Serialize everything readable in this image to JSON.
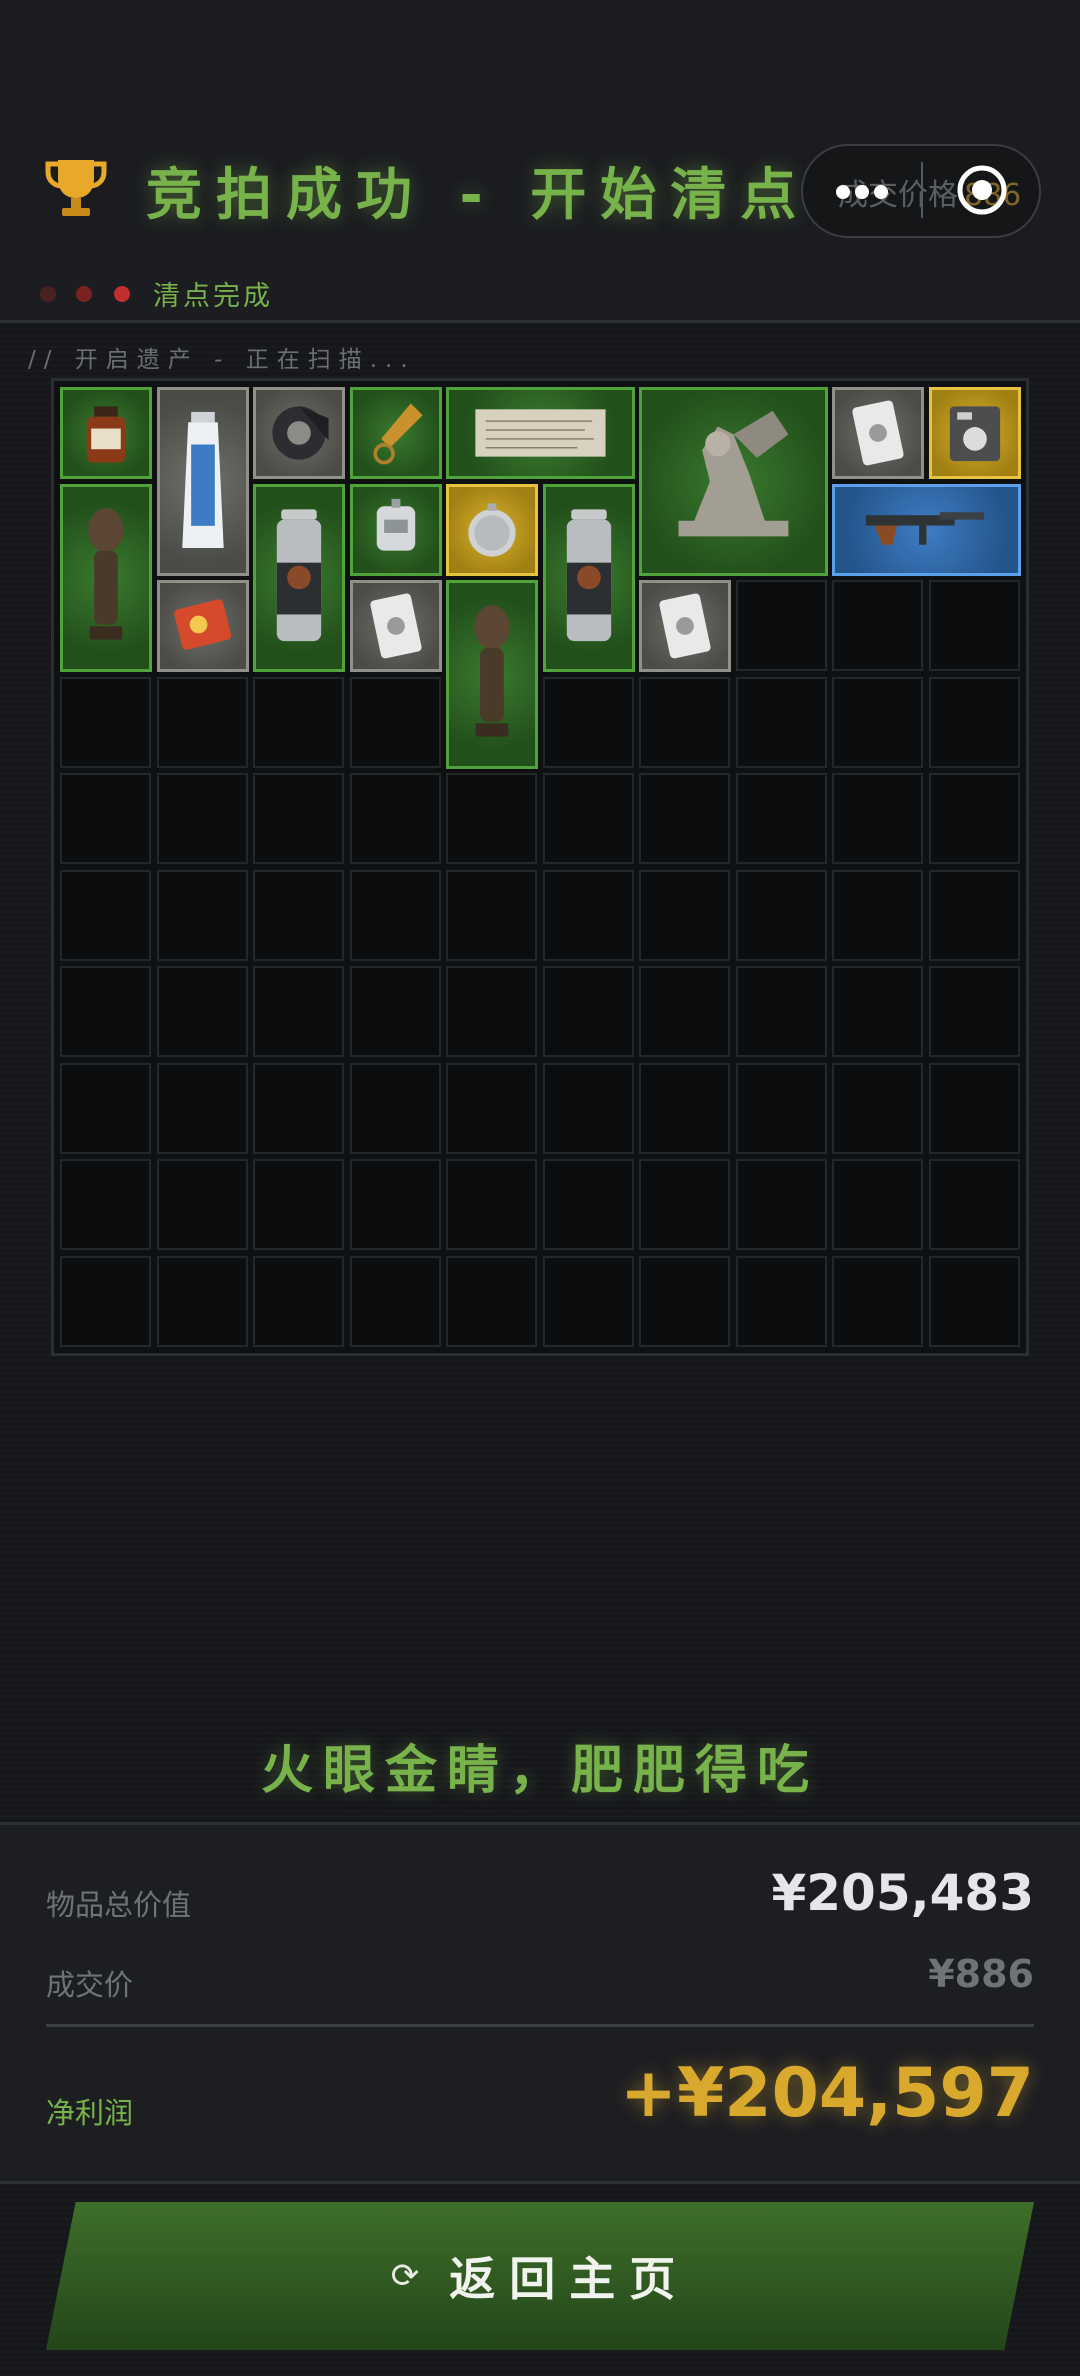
{
  "header": {
    "title": "竞拍成功 - 开始清点",
    "ghost_label": "成交价格",
    "ghost_value": "886"
  },
  "status": {
    "text": "清点完成",
    "scan_line": "// 开启遗产 - 正在扫描..."
  },
  "inventory": {
    "columns": 10,
    "rows": 10,
    "items": [
      {
        "name": "medicine-bottle",
        "rarity": "green",
        "icon": "bottle-icon"
      },
      {
        "name": "toothpaste-tube",
        "rarity": "gray",
        "icon": "tube-icon"
      },
      {
        "name": "duct-tape",
        "rarity": "gray",
        "icon": "tape-icon"
      },
      {
        "name": "bullet-keychain",
        "rarity": "green",
        "icon": "bullet-icon"
      },
      {
        "name": "old-document",
        "rarity": "green",
        "icon": "document-icon"
      },
      {
        "name": "sphinx-statue",
        "rarity": "green",
        "icon": "sphinx-icon"
      },
      {
        "name": "playing-card",
        "rarity": "gray",
        "icon": "card-icon"
      },
      {
        "name": "radio-device",
        "rarity": "gold",
        "icon": "radio-icon"
      },
      {
        "name": "tribal-statue",
        "rarity": "green",
        "icon": "statue-icon"
      },
      {
        "name": "energy-drink",
        "rarity": "green",
        "icon": "can-icon"
      },
      {
        "name": "iv-bag",
        "rarity": "green",
        "icon": "ivbag-icon"
      },
      {
        "name": "pocket-watch",
        "rarity": "gold",
        "icon": "watch-icon"
      },
      {
        "name": "energy-drink",
        "rarity": "green",
        "icon": "can-icon"
      },
      {
        "name": "assault-rifle",
        "rarity": "blue",
        "icon": "rifle-icon"
      },
      {
        "name": "snack-pack",
        "rarity": "gray",
        "icon": "snack-icon"
      },
      {
        "name": "portrait-card",
        "rarity": "gray",
        "icon": "card-icon"
      },
      {
        "name": "tribal-statue",
        "rarity": "green",
        "icon": "statue-icon"
      },
      {
        "name": "portrait-card",
        "rarity": "gray",
        "icon": "card-icon"
      }
    ]
  },
  "slogan": "火眼金睛，肥肥得吃",
  "summary": {
    "total_label": "物品总价值",
    "total_value": "¥205,483",
    "deal_label": "成交价",
    "deal_value": "¥886",
    "profit_label": "净利润",
    "profit_value": "+¥204,597"
  },
  "home_button": {
    "label": "返回主页",
    "icon": "refresh-icon"
  },
  "colors": {
    "accent_green": "#77b24a",
    "gold": "#d9a92e",
    "rarity_green": "#2f6a26",
    "rarity_gray": "#5d5e59",
    "rarity_gold": "#c9a41f",
    "rarity_blue": "#3470b3"
  }
}
